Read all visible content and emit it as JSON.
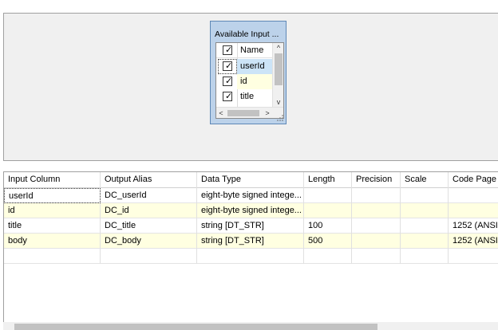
{
  "available_box": {
    "title": "Available Input ...",
    "header": "Name",
    "columns": [
      {
        "name": "userId",
        "checked": true,
        "state": "selected"
      },
      {
        "name": "id",
        "checked": true,
        "state": "highlight"
      },
      {
        "name": "title",
        "checked": true,
        "state": "normal"
      }
    ],
    "check_glyph": "✓",
    "scroll_up": "^",
    "scroll_down": "v",
    "scroll_left": "<",
    "scroll_right": ">"
  },
  "grid": {
    "headers": [
      "Input Column",
      "Output Alias",
      "Data Type",
      "Length",
      "Precision",
      "Scale",
      "Code Page"
    ],
    "rows": [
      {
        "input": "userId",
        "alias": "DC_userId",
        "type": "eight-byte signed intege...",
        "length": "",
        "precision": "",
        "scale": "",
        "codepage": "",
        "highlight": false
      },
      {
        "input": "id",
        "alias": "DC_id",
        "type": "eight-byte signed intege...",
        "length": "",
        "precision": "",
        "scale": "",
        "codepage": "",
        "highlight": true
      },
      {
        "input": "title",
        "alias": "DC_title",
        "type": "string [DT_STR]",
        "length": "100",
        "precision": "",
        "scale": "",
        "codepage": "1252  (ANSI",
        "highlight": false
      },
      {
        "input": "body",
        "alias": "DC_body",
        "type": "string [DT_STR]",
        "length": "500",
        "precision": "",
        "scale": "",
        "codepage": "1252  (ANSI",
        "highlight": true
      }
    ]
  },
  "colors": {
    "designer_bg": "#f0f0f0",
    "box_bg": "#bcd2ea",
    "box_border": "#5e88b6",
    "selection": "#cce4f7",
    "row_highlight": "#ffffe1"
  }
}
